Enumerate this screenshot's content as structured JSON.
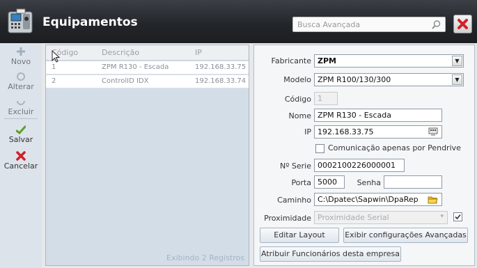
{
  "header": {
    "title": "Equipamentos",
    "search_placeholder": "Busca Avançada"
  },
  "toolbar": {
    "novo": "Novo",
    "alterar": "Alterar",
    "excluir": "Excluir",
    "salvar": "Salvar",
    "cancelar": "Cancelar"
  },
  "grid": {
    "columns": [
      "Código",
      "Descrição",
      "IP"
    ],
    "rows": [
      {
        "codigo": "1",
        "descricao": "ZPM R130 - Escada",
        "ip": "192.168.33.75"
      },
      {
        "codigo": "2",
        "descricao": "ControlID IDX",
        "ip": "192.168.33.74"
      }
    ],
    "footer": "Exibindo 2 Registros"
  },
  "form": {
    "fabricante_label": "Fabricante",
    "fabricante_value": "ZPM",
    "modelo_label": "Modelo",
    "modelo_value": "ZPM R100/130/300",
    "codigo_label": "Código",
    "codigo_value": "1",
    "nome_label": "Nome",
    "nome_value": "ZPM R130 - Escada",
    "ip_label": "IP",
    "ip_value": "192.168.33.75",
    "pendrive_label": "Comunicação apenas por Pendrive",
    "pendrive_checked": false,
    "serie_label": "Nº Serie",
    "serie_value": "0002100226000001",
    "porta_label": "Porta",
    "porta_value": "5000",
    "senha_label": "Senha",
    "senha_value": "",
    "caminho_label": "Caminho",
    "caminho_value": "C:\\Dpatec\\Sapwin\\DpaRep",
    "proximidade_label": "Proximidade",
    "proximidade_value": "Proximidade Serial",
    "proximidade_checked": true,
    "btn_editar": "Editar Layout",
    "btn_exibir": "Exibir configurações Avançadas",
    "btn_atribuir": "Atribuir Funcionários desta empresa"
  },
  "colors": {
    "header_bg": "#23262a",
    "toolbar_bg": "#dde3ea",
    "grid_bg": "#d3dde8",
    "close_red": "#d0202a",
    "folder_yellow": "#f0c020"
  }
}
